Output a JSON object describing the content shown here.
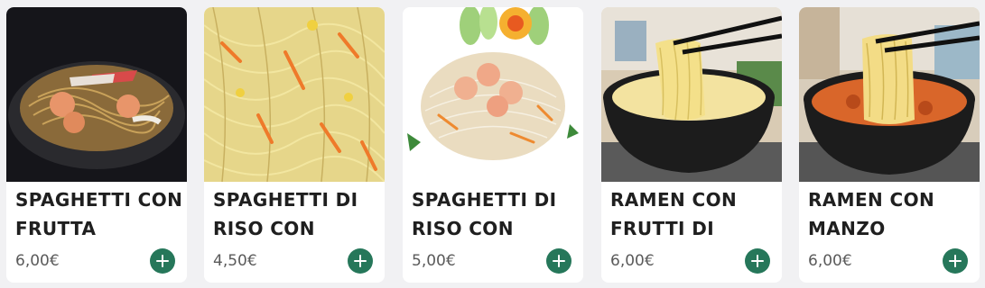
{
  "products": [
    {
      "name": "SPAGHETTI CON FRUTTA",
      "price": "6,00€",
      "image_icon": "noodles-with-shrimp-photo"
    },
    {
      "name": "SPAGHETTI DI RISO CON",
      "price": "4,50€",
      "image_icon": "rice-noodles-vegetables-photo"
    },
    {
      "name": "SPAGHETTI DI RISO CON",
      "price": "5,00€",
      "image_icon": "rice-noodles-shrimp-photo"
    },
    {
      "name": "RAMEN CON FRUTTI DI",
      "price": "6,00€",
      "image_icon": "ramen-seafood-photo"
    },
    {
      "name": "RAMEN CON MANZO",
      "price": "6,00€",
      "image_icon": "ramen-beef-photo"
    }
  ],
  "colors": {
    "background": "#f1f1f3",
    "card": "#ffffff",
    "add_button": "#26775a",
    "name_text": "#1f1f1f",
    "price_text": "#5a5a5a"
  },
  "add_button_icon": "plus-icon"
}
